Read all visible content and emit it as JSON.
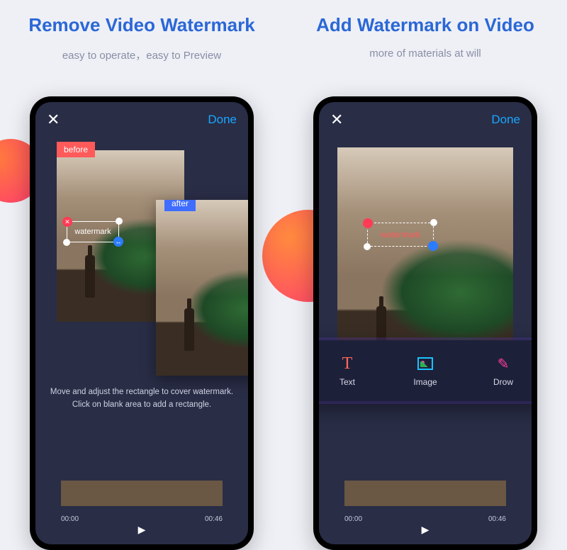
{
  "left": {
    "headline": "Remove Video Watermark",
    "subline": "easy to operate，easy to Preview",
    "close": "✕",
    "done": "Done",
    "before_tag": "before",
    "after_tag": "after",
    "watermark_label": "watermark",
    "hint_line1": "Move and adjust the rectangle to cover watermark.",
    "hint_line2": "Click on blank area to add a rectangle.",
    "time_start": "00:00",
    "time_end": "00:46",
    "play": "▶"
  },
  "right": {
    "headline": "Add Watermark on Video",
    "subline": "more of materials at will",
    "close": "✕",
    "done": "Done",
    "watermark_label": "watermark",
    "tools": {
      "text": "Text",
      "image": "Image",
      "draw": "Drow"
    },
    "time_start": "00:00",
    "time_end": "00:46",
    "play": "▶"
  }
}
